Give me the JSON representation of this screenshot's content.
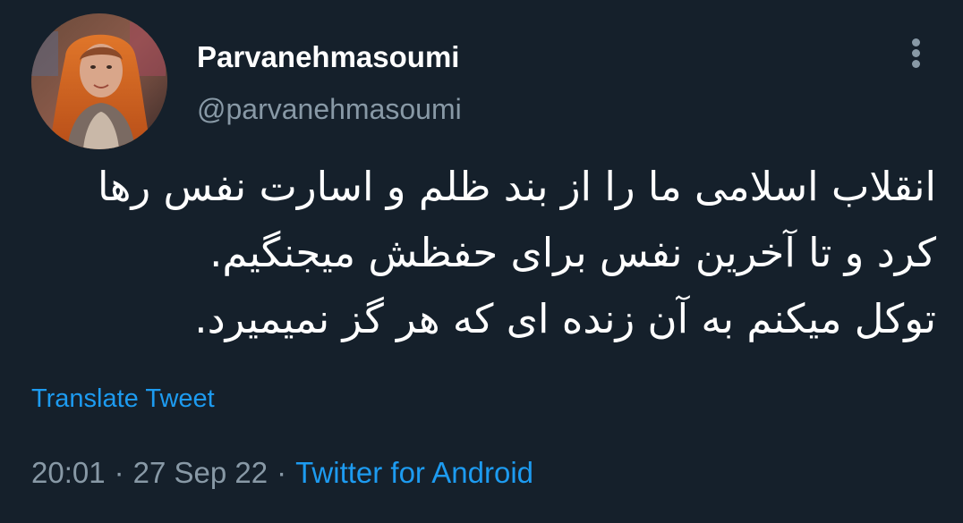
{
  "tweet": {
    "author": {
      "display_name": "Parvanehmasoumi",
      "username": "@parvanehmasoumi",
      "avatar_icon": "profile-photo"
    },
    "more_icon": "more-vertical-icon",
    "text_lines": [
      "انقلاب اسلامی ما را از بند ظلم و اسارت نفس رها",
      "کرد و تا آخرین نفس برای حفظش میجنگیم.",
      "توکل میکنم به آن زنده ای که هر گز نمیمیرد."
    ],
    "translate_label": "Translate Tweet",
    "meta": {
      "time": "20:01",
      "separator": "·",
      "date": "27 Sep 22",
      "source": "Twitter for Android"
    }
  },
  "colors": {
    "background": "#15202b",
    "primary_text": "#ffffff",
    "secondary_text": "#8899a6",
    "link": "#1d9bf0"
  }
}
